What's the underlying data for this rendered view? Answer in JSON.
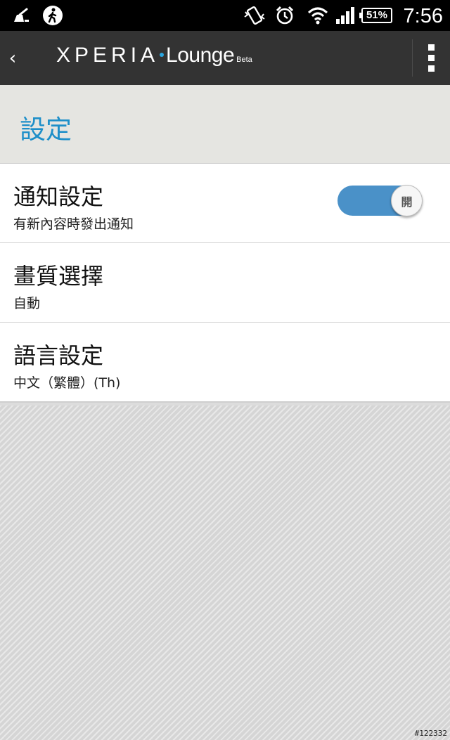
{
  "status_bar": {
    "time": "7:56",
    "battery": "51%",
    "icons": [
      "cleaner-icon",
      "walking-icon",
      "vibrate-icon",
      "alarm-icon",
      "wifi-icon",
      "signal-icon",
      "battery-icon"
    ]
  },
  "action_bar": {
    "back_glyph": "‹",
    "logo_word": "XPERIA",
    "logo_product": "Lounge",
    "logo_badge": "Beta"
  },
  "page": {
    "title": "設定"
  },
  "settings": [
    {
      "title": "通知設定",
      "subtitle": "有新內容時發出通知",
      "toggle_label": "開",
      "toggle_on": true
    },
    {
      "title": "畫質選擇",
      "subtitle": "自動"
    },
    {
      "title": "語言設定",
      "subtitle": "中文（繁體）(Th)"
    }
  ],
  "colors": {
    "accent": "#1e8fc9",
    "toggle_on": "#4a91c8",
    "action_bar": "#333333"
  },
  "watermark": "#122332"
}
